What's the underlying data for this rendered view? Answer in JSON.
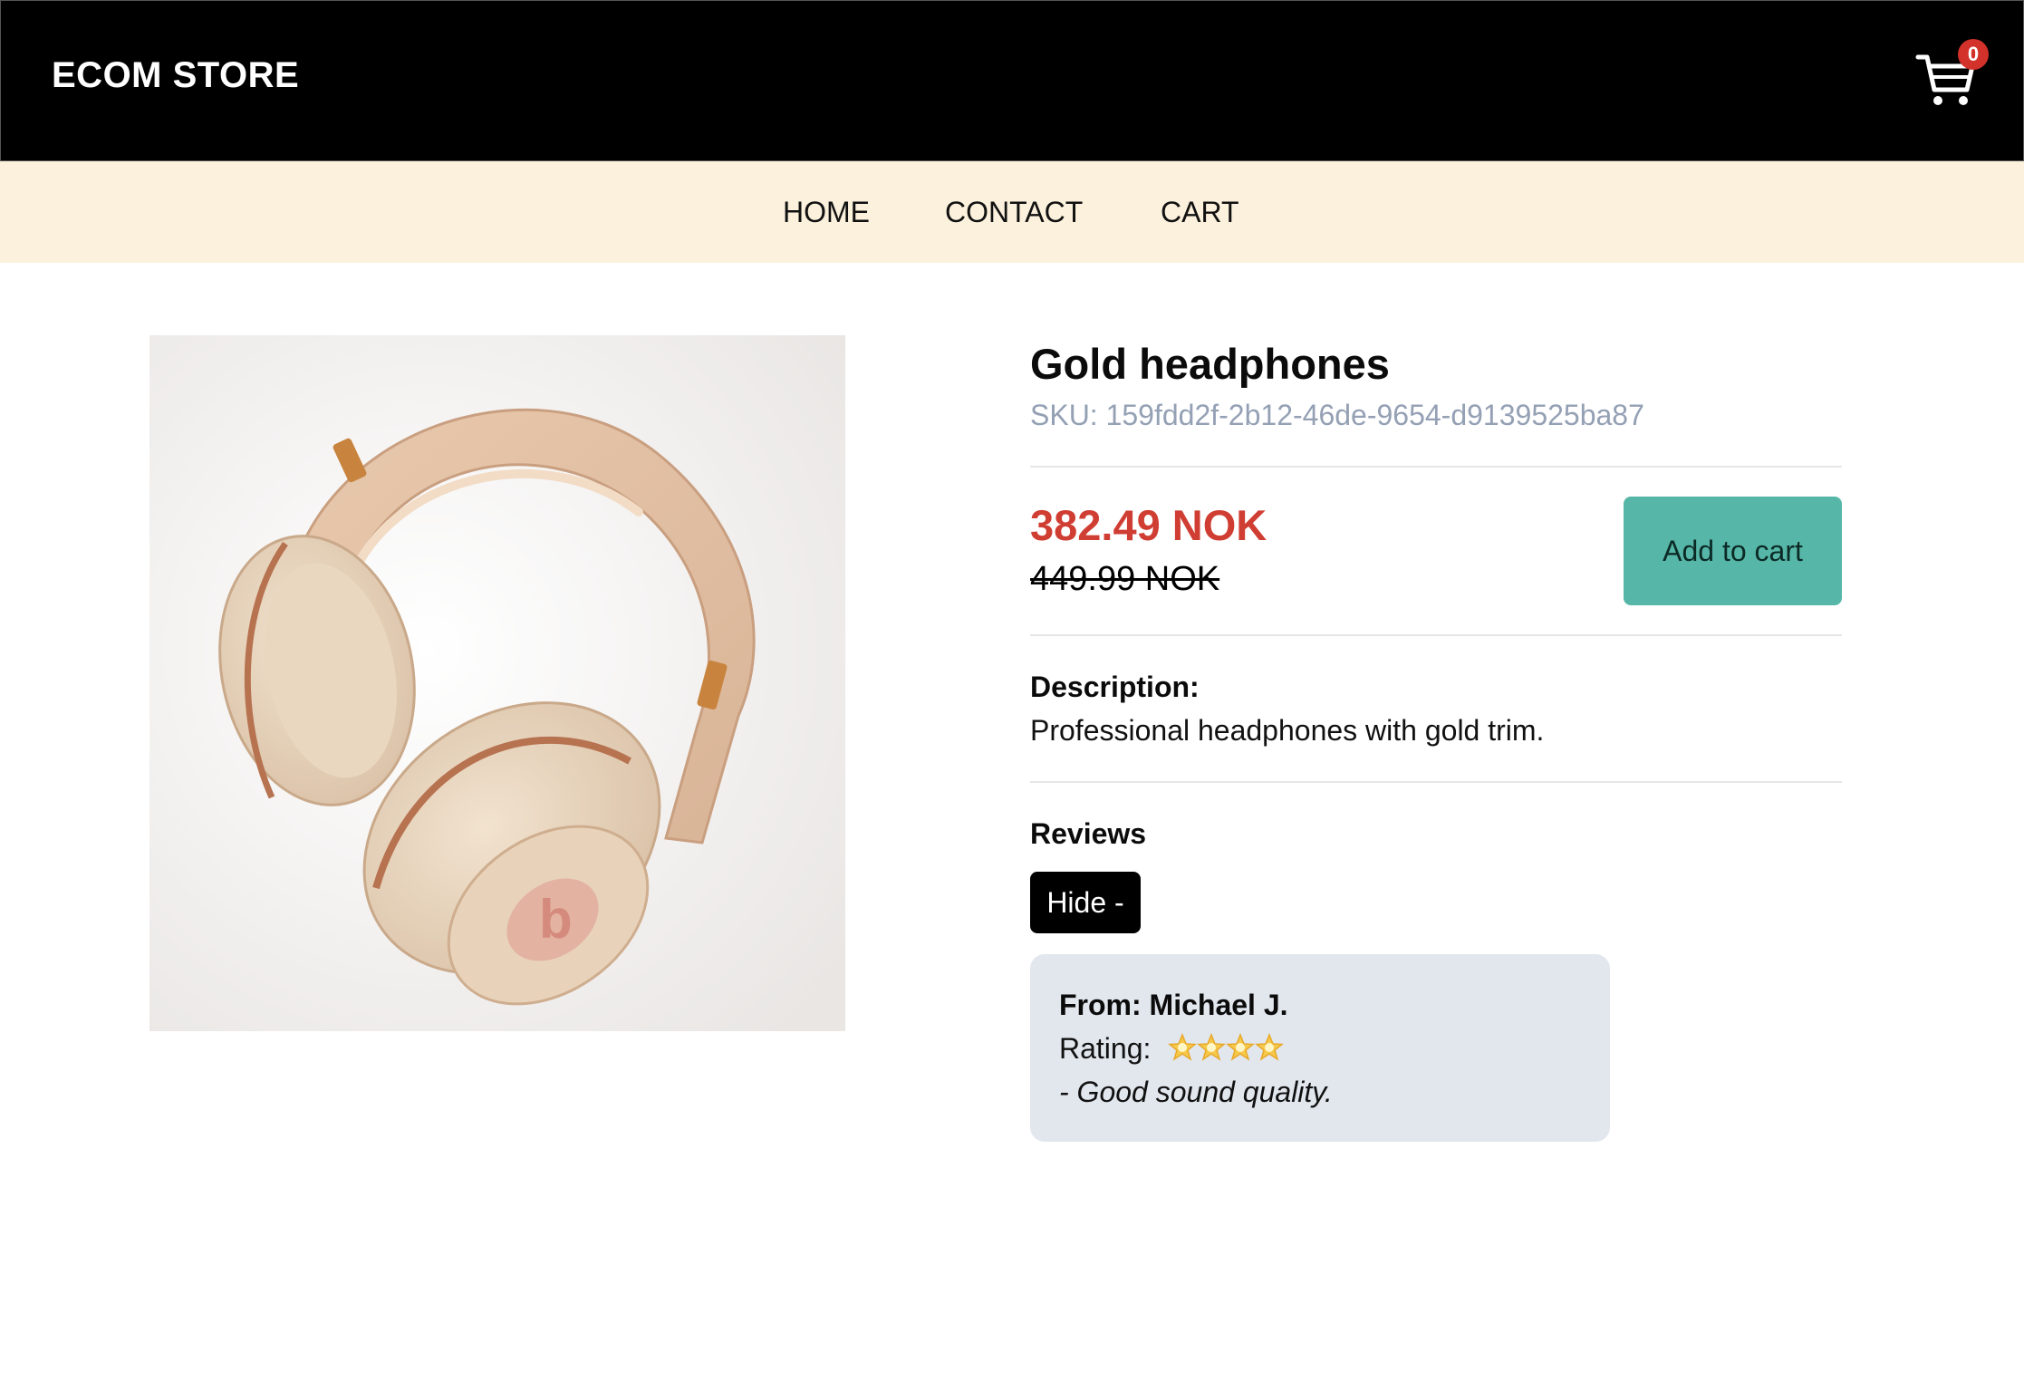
{
  "header": {
    "brand": "ECOM STORE",
    "cart_count": "0"
  },
  "nav": {
    "items": [
      {
        "label": "HOME"
      },
      {
        "label": "CONTACT"
      },
      {
        "label": "CART"
      }
    ]
  },
  "product": {
    "title": "Gold headphones",
    "sku": "SKU: 159fdd2f-2b12-46de-9654-d9139525ba87",
    "price": "382.49 NOK",
    "old_price": "449.99 NOK",
    "add_to_cart_label": "Add to cart",
    "description_label": "Description:",
    "description": "Professional headphones with gold trim.",
    "image_alt": "Gold headphones"
  },
  "reviews": {
    "label": "Reviews",
    "toggle_label": "Hide -",
    "items": [
      {
        "from": "From: Michael J.",
        "rating_label": "Rating:",
        "rating": 4,
        "comment": "- Good sound quality."
      }
    ]
  },
  "colors": {
    "header_bg": "#000000",
    "nav_bg": "#fcf1dc",
    "price": "#d03e33",
    "add_button": "#56b7a8",
    "badge": "#d3322a",
    "review_card": "#e2e7ee",
    "sku": "#94a0b4"
  }
}
